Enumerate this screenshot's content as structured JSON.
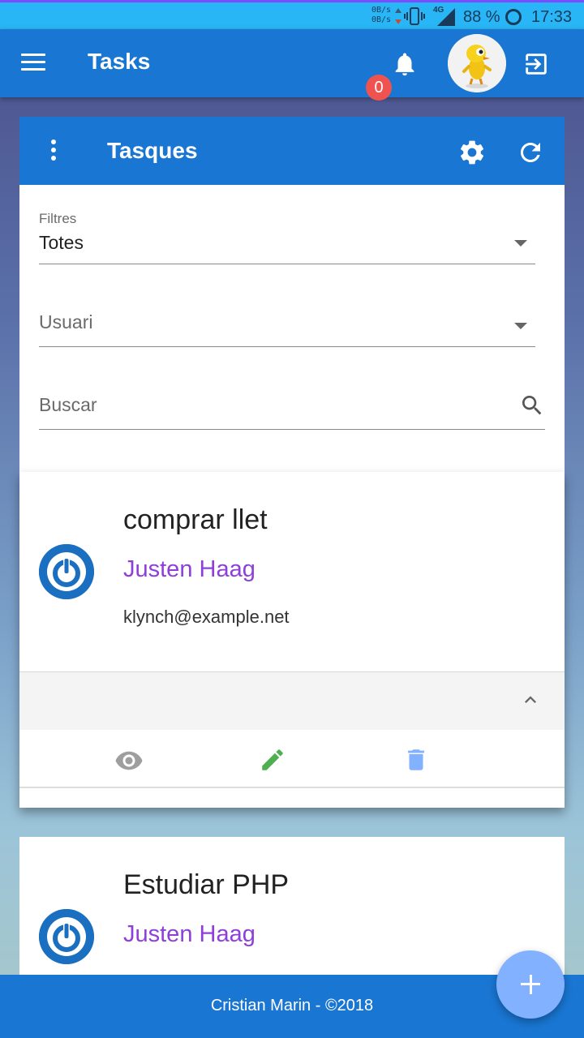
{
  "status_bar": {
    "net_up": "0B/s",
    "net_down": "0B/s",
    "network_type": "4G",
    "battery": "88 %",
    "time": "17:33",
    "icons": [
      "vibrate-icon",
      "signal-icon",
      "battery-icon"
    ]
  },
  "appbar": {
    "title": "Tasks",
    "notification_count": "0",
    "icons": [
      "menu-icon",
      "bell-icon",
      "avatar",
      "logout-icon"
    ]
  },
  "card": {
    "title": "Tasques",
    "icons": [
      "more-vert-icon",
      "settings-icon",
      "refresh-icon"
    ],
    "filters": {
      "filter_label": "Filtres",
      "filter_value": "Totes",
      "user_placeholder": "Usuari",
      "search_placeholder": "Buscar"
    },
    "tasks": [
      {
        "name": "comprar llet",
        "user": "Justen Haag",
        "email": "klynch@example.net",
        "actions": [
          "view-icon",
          "edit-icon",
          "delete-icon"
        ]
      },
      {
        "name": "Estudiar PHP",
        "user": "Justen Haag"
      }
    ]
  },
  "footer": {
    "text": "Cristian Marin - ©2018"
  },
  "colors": {
    "primary": "#1976d2",
    "status_bar": "#29b6f6",
    "badge": "#ef5350",
    "user_link": "#8e3fd8",
    "view_icon": "#9e9e9e",
    "edit_icon": "#4caf50",
    "delete_icon": "#82b1ff",
    "fab": "#82b1ff"
  }
}
